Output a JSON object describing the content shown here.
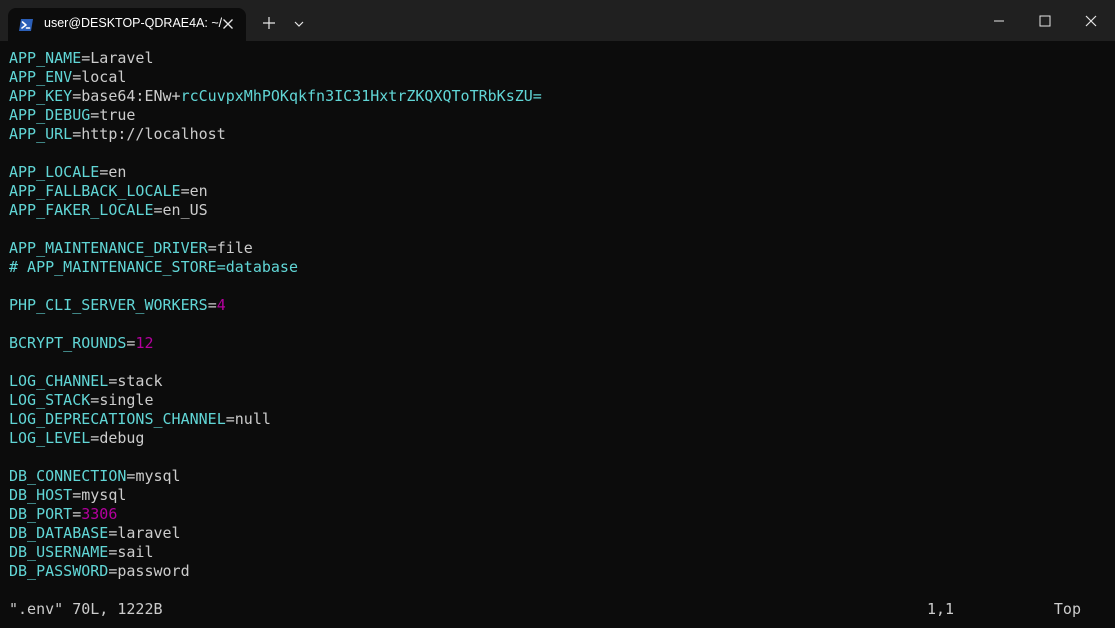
{
  "window": {
    "tab_title": "user@DESKTOP-QDRAE4A: ~/",
    "tab_icon": "powershell-icon",
    "new_tab_icon": "plus-icon",
    "dropdown_icon": "chevron-down-icon",
    "controls": [
      "minimize-icon",
      "maximize-icon",
      "close-icon"
    ]
  },
  "colors": {
    "background": "#0c0c0c",
    "titlebar": "#202020",
    "key": "#61d6d6",
    "text": "#cccccc",
    "number": "#b4009e"
  },
  "lines": [
    {
      "key": "APP_NAME",
      "value": "Laravel"
    },
    {
      "key": "APP_ENV",
      "value": "local"
    },
    {
      "key": "APP_KEY",
      "value": "base64:ENw+",
      "value_b64": "rcCuvpxMhPOKqkfn3IC31HxtrZKQXQToTRbKsZU="
    },
    {
      "key": "APP_DEBUG",
      "value": "true"
    },
    {
      "key": "APP_URL",
      "value": "http://localhost"
    },
    {
      "blank": true
    },
    {
      "key": "APP_LOCALE",
      "value": "en"
    },
    {
      "key": "APP_FALLBACK_LOCALE",
      "value": "en"
    },
    {
      "key": "APP_FAKER_LOCALE",
      "value": "en_US"
    },
    {
      "blank": true
    },
    {
      "key": "APP_MAINTENANCE_DRIVER",
      "value": "file"
    },
    {
      "comment": "# APP_MAINTENANCE_STORE=database"
    },
    {
      "blank": true
    },
    {
      "key": "PHP_CLI_SERVER_WORKERS",
      "number": "4"
    },
    {
      "blank": true
    },
    {
      "key": "BCRYPT_ROUNDS",
      "number": "12"
    },
    {
      "blank": true
    },
    {
      "key": "LOG_CHANNEL",
      "value": "stack"
    },
    {
      "key": "LOG_STACK",
      "value": "single"
    },
    {
      "key": "LOG_DEPRECATIONS_CHANNEL",
      "value": "null"
    },
    {
      "key": "LOG_LEVEL",
      "value": "debug"
    },
    {
      "blank": true
    },
    {
      "key": "DB_CONNECTION",
      "value": "mysql"
    },
    {
      "key": "DB_HOST",
      "value": "mysql"
    },
    {
      "key": "DB_PORT",
      "number": "3306"
    },
    {
      "key": "DB_DATABASE",
      "value": "laravel"
    },
    {
      "key": "DB_USERNAME",
      "value": "sail"
    },
    {
      "key": "DB_PASSWORD",
      "value": "password"
    }
  ],
  "status": {
    "file": "\".env\" 70L, 1222B",
    "position": "1,1",
    "scroll": "Top"
  }
}
